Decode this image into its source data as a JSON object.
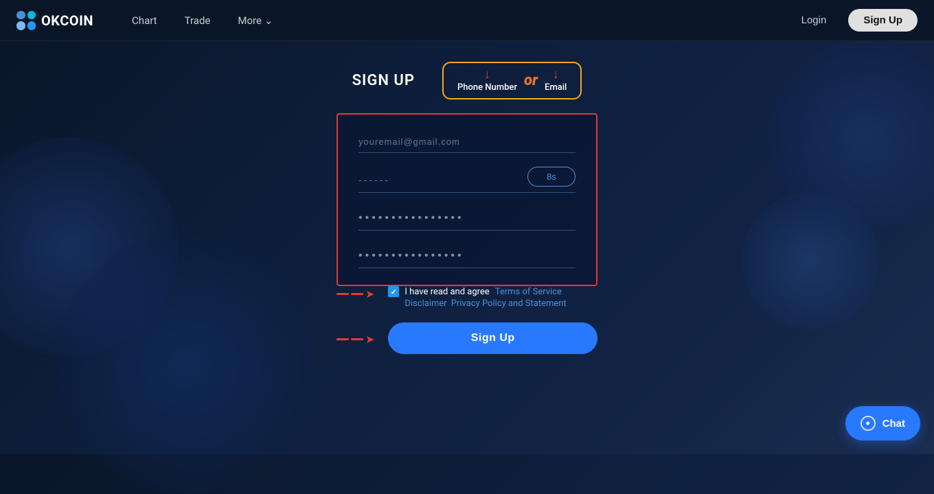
{
  "navbar": {
    "brand": "OKCOIN",
    "nav_items": [
      {
        "label": "Chart",
        "id": "chart"
      },
      {
        "label": "Trade",
        "id": "trade"
      },
      {
        "label": "More",
        "id": "more",
        "has_dropdown": true
      }
    ],
    "login_label": "Login",
    "signup_label": "Sign Up"
  },
  "tabs": {
    "or_text": "or",
    "phone_label": "Phone Number",
    "email_label": "Email",
    "divider": "|"
  },
  "form": {
    "title": "SIGN UP",
    "email_placeholder": "youremail@gmail.com",
    "code_placeholder": "------",
    "send_code_label": "8s",
    "password_dots": "••••••••••••••••",
    "confirm_password_dots": "••••••••••••••••"
  },
  "terms": {
    "agree_text": "I have read and agree",
    "terms_of_service": "Terms of Service",
    "disclaimer": "Disclaimer",
    "privacy": "Privacy Policy and Statement"
  },
  "signup_button": "Sign Up",
  "chat": {
    "label": "Chat"
  }
}
